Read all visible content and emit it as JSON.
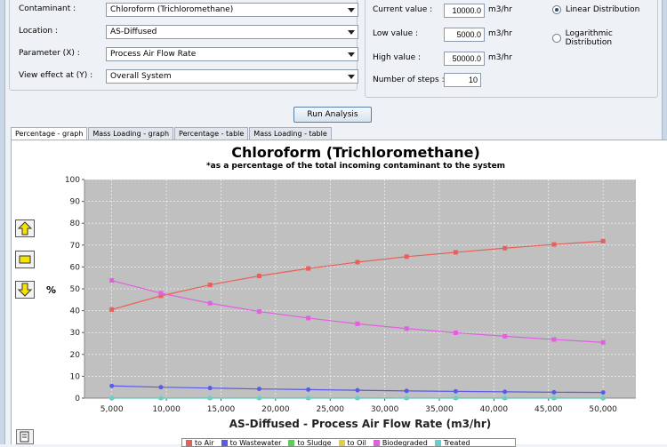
{
  "form": {
    "contaminant_label": "Contaminant :",
    "contaminant_value": "Chloroform (Trichloromethane)",
    "location_label": "Location :",
    "location_value": "AS-Diffused",
    "parameter_label": "Parameter (X) :",
    "parameter_value": "Process Air Flow Rate",
    "view_label": "View effect at (Y) :",
    "view_value": "Overall System"
  },
  "range": {
    "current_label": "Current value :",
    "current_value": "10000.0",
    "low_label": "Low value :",
    "low_value": "5000.0",
    "high_label": "High value :",
    "high_value": "50000.0",
    "steps_label": "Number of steps :",
    "steps_value": "10",
    "unit": "m3/hr",
    "linear_label": "Linear Distribution",
    "log_label": "Logarithmic Distribution",
    "selected_distribution": "linear"
  },
  "run_button": "Run Analysis",
  "tabs": [
    {
      "label": "Percentage - graph",
      "active": true
    },
    {
      "label": "Mass Loading - graph",
      "active": false
    },
    {
      "label": "Percentage - table",
      "active": false
    },
    {
      "label": "Mass Loading - table",
      "active": false
    }
  ],
  "side_icons": [
    "up-arrow-icon",
    "fit-view-icon",
    "down-arrow-icon",
    "copy-icon"
  ],
  "chart_data": {
    "type": "line",
    "title": "Chloroform (Trichloromethane)",
    "subtitle": "*as a percentage of the total incoming contaminant to the system",
    "xlabel": "AS-Diffused - Process Air Flow Rate (m3/hr)",
    "ylabel": "%",
    "xlim": [
      2500,
      53000
    ],
    "ylim": [
      0,
      100
    ],
    "x_ticks": [
      5000,
      10000,
      15000,
      20000,
      25000,
      30000,
      35000,
      40000,
      45000,
      50000
    ],
    "x_tick_labels": [
      "5,000",
      "10,000",
      "15,000",
      "20,000",
      "25,000",
      "30,000",
      "35,000",
      "40,000",
      "45,000",
      "50,000"
    ],
    "y_ticks": [
      0,
      10,
      20,
      30,
      40,
      50,
      60,
      70,
      80,
      90,
      100
    ],
    "x": [
      5000,
      9500,
      14000,
      18500,
      23000,
      27500,
      32000,
      36500,
      41000,
      45500,
      50000
    ],
    "series": [
      {
        "name": "to Air",
        "color": "#e8605a",
        "marker": "square",
        "values": [
          40.5,
          46.8,
          51.8,
          55.9,
          59.3,
          62.2,
          64.7,
          66.7,
          68.6,
          70.3,
          71.8
        ]
      },
      {
        "name": "to Wastewater",
        "color": "#5a5ae8",
        "marker": "circle",
        "values": [
          5.6,
          5.0,
          4.6,
          4.2,
          3.9,
          3.6,
          3.3,
          3.1,
          2.9,
          2.7,
          2.6
        ]
      },
      {
        "name": "to Sludge",
        "color": "#5ad05a",
        "marker": "triangle",
        "values": [
          0.1,
          0.1,
          0.1,
          0.1,
          0.1,
          0.1,
          0.1,
          0.1,
          0.1,
          0.1,
          0.1
        ]
      },
      {
        "name": "to Oil",
        "color": "#e0d040",
        "marker": "diamond",
        "values": [
          0,
          0,
          0,
          0,
          0,
          0,
          0,
          0,
          0,
          0,
          0
        ]
      },
      {
        "name": "Biodegraded",
        "color": "#e060e0",
        "marker": "square",
        "values": [
          53.8,
          48.0,
          43.4,
          39.6,
          36.6,
          34.0,
          31.8,
          29.9,
          28.3,
          26.8,
          25.5
        ]
      },
      {
        "name": "Treated",
        "color": "#60d0d0",
        "marker": "circle",
        "values": [
          0,
          0,
          0,
          0,
          0,
          0,
          0,
          0,
          0,
          0,
          0
        ]
      }
    ]
  }
}
